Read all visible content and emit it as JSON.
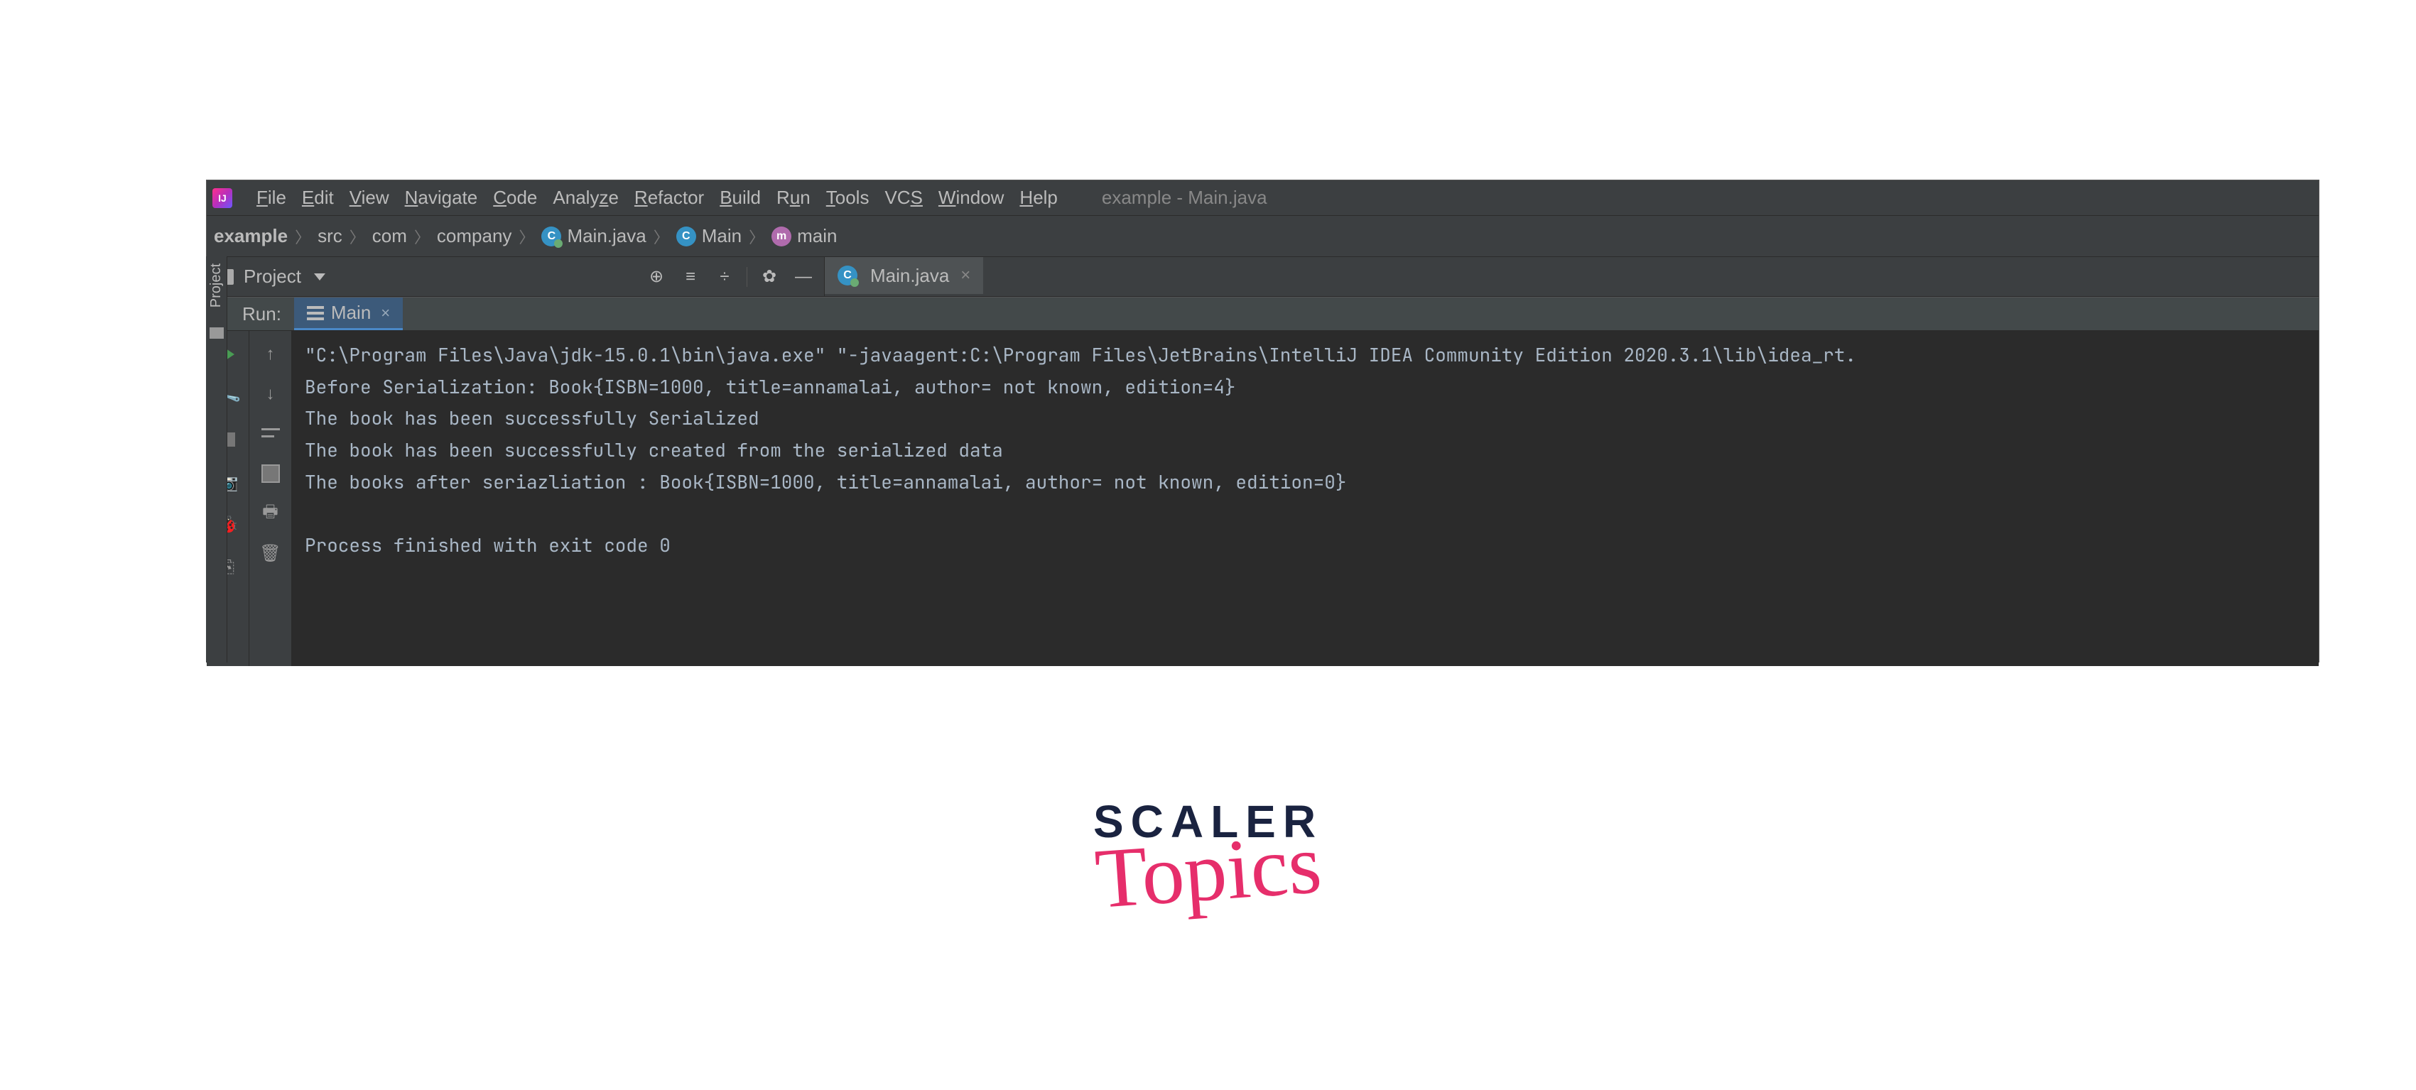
{
  "window_title": "example - Main.java",
  "menu": [
    "File",
    "Edit",
    "View",
    "Navigate",
    "Code",
    "Analyze",
    "Refactor",
    "Build",
    "Run",
    "Tools",
    "VCS",
    "Window",
    "Help"
  ],
  "breadcrumbs": {
    "root": "example",
    "parts": [
      "src",
      "com",
      "company"
    ],
    "file": "Main.java",
    "class": "Main",
    "method": "main"
  },
  "project_tool_label": "Project",
  "left_strip_label": "Project",
  "editor_tab": "Main.java",
  "run_label": "Run:",
  "run_tab_label": "Main",
  "console_lines": [
    "\"C:\\Program Files\\Java\\jdk-15.0.1\\bin\\java.exe\" \"-javaagent:C:\\Program Files\\JetBrains\\IntelliJ IDEA Community Edition 2020.3.1\\lib\\idea_rt.",
    "Before Serialization: Book{ISBN=1000, title=annamalai, author= not known, edition=4}",
    "The book has been successfully Serialized",
    "The book has been successfully created from the serialized data",
    "The books after seriazliation : Book{ISBN=1000, title=annamalai, author= not known, edition=0}",
    "",
    "Process finished with exit code 0"
  ],
  "logo": {
    "line1": "SCALER",
    "line2": "Topics"
  }
}
